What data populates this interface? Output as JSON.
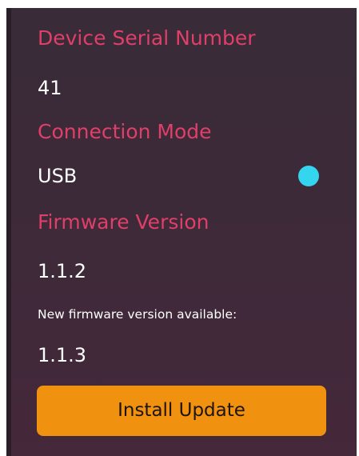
{
  "device": {
    "serial_label": "Device Serial Number",
    "serial_value": "41",
    "connection_label": "Connection Mode",
    "connection_value": "USB",
    "connection_status_color": "#34d6ef",
    "firmware_label": "Firmware Version",
    "firmware_value": "1.1.2",
    "update_note": "New firmware version available:",
    "update_version": "1.1.3",
    "install_button_label": "Install Update"
  },
  "colors": {
    "accent": "#df3f68",
    "button": "#f0920f",
    "panel": "#3d2a39"
  }
}
